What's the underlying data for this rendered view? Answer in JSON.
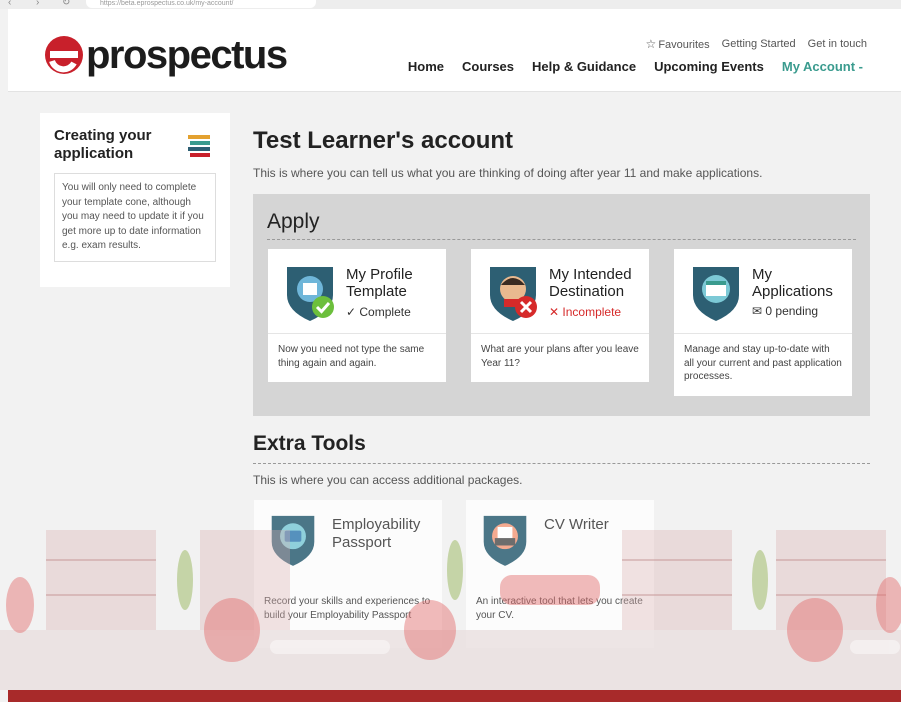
{
  "browser": {
    "url": "https://beta.eprospectus.co.uk/my-account/"
  },
  "brand": {
    "logo_text": "prospectus",
    "logo_color": "#c8202b"
  },
  "top_links": {
    "favourites": "Favourites",
    "getting_started": "Getting Started",
    "get_in_touch": "Get in touch"
  },
  "nav": {
    "home": "Home",
    "courses": "Courses",
    "help": "Help & Guidance",
    "events": "Upcoming Events",
    "account": "My Account -",
    "accent_color": "#3a9b8e"
  },
  "sidebar": {
    "title": "Creating your application",
    "note": "You will only need to complete your template cone, although you may need to update it if you get more up to date information e.g. exam results."
  },
  "main": {
    "title": "Test Learner's account",
    "subtitle": "This is where you can tell us what you are thinking of doing after year 11 and make applications."
  },
  "apply": {
    "heading": "Apply",
    "cards": [
      {
        "title": "My Profile Template",
        "status": "Complete",
        "description": "Now you need not type the same thing again and again."
      },
      {
        "title": "My Intended Destination",
        "status": "Incomplete",
        "description": "What are your plans after you leave Year 11?"
      },
      {
        "title": "My Applications",
        "status": "0 pending",
        "description": "Manage and stay up-to-date with all your current and past application processes."
      }
    ]
  },
  "extra": {
    "heading": "Extra Tools",
    "subtitle": "This is where you can access additional packages.",
    "tools": [
      {
        "title": "Employability Passport",
        "description": "Record your skills and experiences to build your Employability Passport"
      },
      {
        "title": "CV Writer",
        "description": "An interactive tool that lets you create your CV."
      }
    ]
  },
  "colors": {
    "complete": "#2f7d3a",
    "incomplete": "#d62a2a",
    "shield": "#2d5f73",
    "footer": "#a82a2a"
  }
}
